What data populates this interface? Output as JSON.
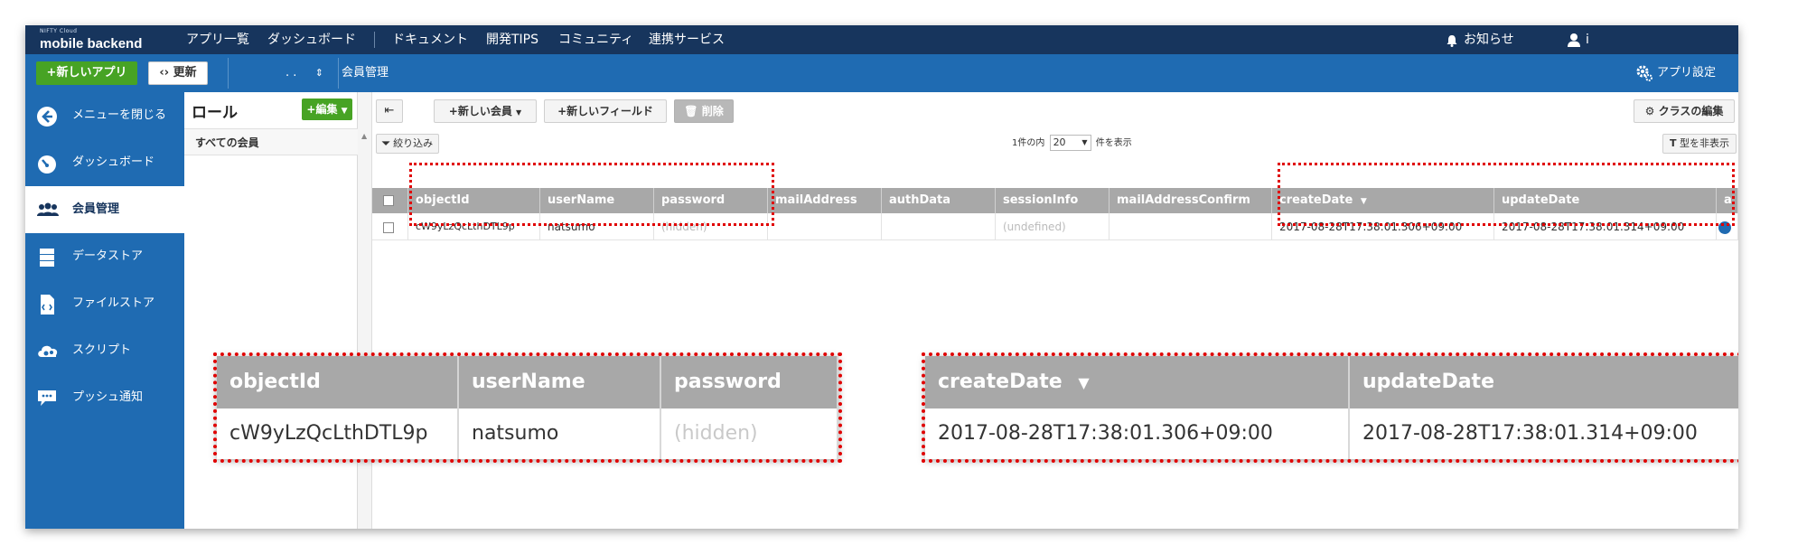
{
  "topnav": {
    "logo_small": "NIFTY Cloud",
    "logo_big": "mobile backend",
    "items": [
      "アプリ一覧",
      "ダッシュボード",
      "ドキュメント",
      "開発TIPS",
      "コミュニティ",
      "連携サービス"
    ],
    "notifications": "お知らせ",
    "user": "i"
  },
  "toolbar": {
    "new_app": "+新しいアプリ",
    "refresh": "更新",
    "app_name": ". .",
    "section": "会員管理",
    "app_settings": "アプリ設定"
  },
  "sidebar": {
    "items": [
      {
        "label": "メニューを閉じる",
        "icon": "arrow-left-circle-icon"
      },
      {
        "label": "ダッシュボード",
        "icon": "gauge-icon"
      },
      {
        "label": "会員管理",
        "icon": "users-icon",
        "active": true
      },
      {
        "label": "データストア",
        "icon": "database-icon"
      },
      {
        "label": "ファイルストア",
        "icon": "file-icon"
      },
      {
        "label": "スクリプト",
        "icon": "cloud-script-icon"
      },
      {
        "label": "プッシュ通知",
        "icon": "chat-bubble-icon"
      }
    ]
  },
  "roles": {
    "title": "ロール",
    "edit_button": "+編集",
    "all_members": "すべての会員"
  },
  "grid_toolbar": {
    "new_member": "+新しい会員",
    "new_field": "+新しいフィールド",
    "delete": "削除",
    "class_edit": "クラスの編集",
    "filter": "絞り込み",
    "paging_prefix": "1件の内",
    "page_size": "20",
    "paging_suffix": "件を表示",
    "hide_types": "型を非表示"
  },
  "table": {
    "columns": [
      "objectId",
      "userName",
      "password",
      "mailAddress",
      "authData",
      "sessionInfo",
      "mailAddressConfirm",
      "createDate",
      "updateDate",
      "a"
    ],
    "row": [
      "cW9yLzQcLthDTL9p",
      "natsumo",
      "(hidden)",
      "",
      "",
      "(undefined)",
      "",
      "2017-08-28T17:38:01.306+09:00",
      "2017-08-28T17:38:01.314+09:00",
      ""
    ]
  },
  "zoom_left": {
    "columns": [
      "objectId",
      "userName",
      "password"
    ],
    "row": [
      "cW9yLzQcLthDTL9p",
      "natsumo",
      "(hidden)"
    ]
  },
  "zoom_right": {
    "columns": [
      "createDate",
      "updateDate"
    ],
    "row": [
      "2017-08-28T17:38:01.306+09:00",
      "2017-08-28T17:38:01.314+09:00"
    ]
  },
  "colors": {
    "navy": "#17355d",
    "blue": "#1f6bb2",
    "green": "#47a324",
    "header_gray": "#a8a8a8",
    "highlight_red": "#e00000"
  }
}
